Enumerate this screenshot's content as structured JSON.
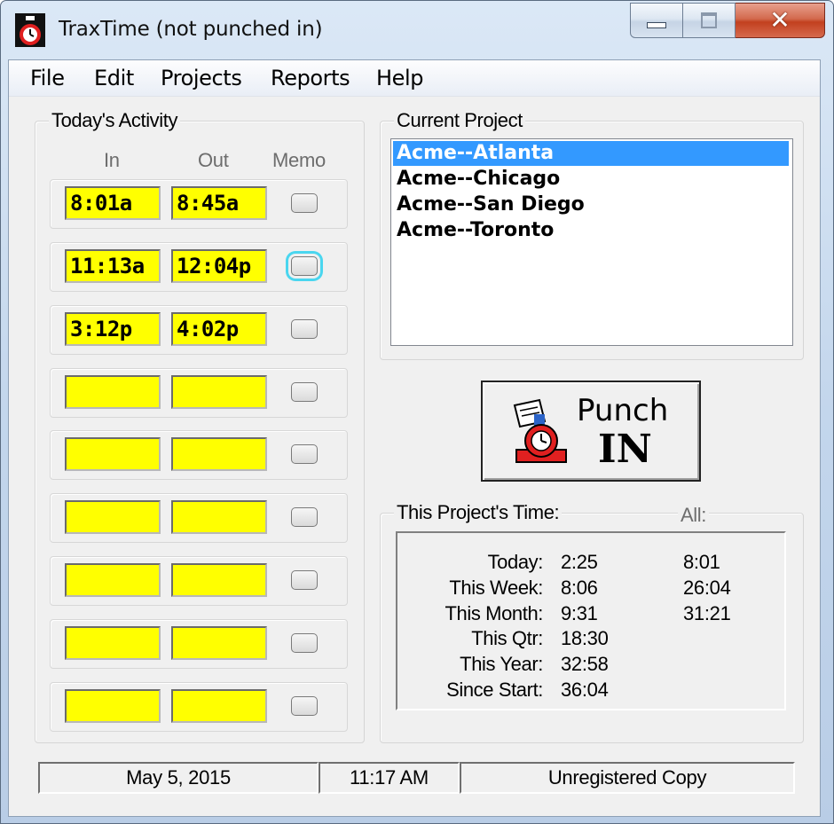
{
  "window": {
    "title": "TraxTime (not punched in)",
    "caption": {
      "minimize": "minimize",
      "maximize": "maximize",
      "close_glyph": "✕"
    }
  },
  "menu": [
    "File",
    "Edit",
    "Projects",
    "Reports",
    "Help"
  ],
  "activity": {
    "label": "Today's Activity",
    "col_in": "In",
    "col_out": "Out",
    "col_memo": "Memo",
    "rows": [
      {
        "in": "8:01a",
        "out": "8:45a"
      },
      {
        "in": "11:13a",
        "out": "12:04p"
      },
      {
        "in": "3:12p",
        "out": "4:02p"
      },
      {
        "in": "",
        "out": ""
      },
      {
        "in": "",
        "out": ""
      },
      {
        "in": "",
        "out": ""
      },
      {
        "in": "",
        "out": ""
      },
      {
        "in": "",
        "out": ""
      },
      {
        "in": "",
        "out": ""
      }
    ],
    "focused_memo_row": 2
  },
  "project": {
    "label": "Current Project",
    "items": [
      "Acme--Atlanta",
      "Acme--Chicago",
      "Acme--San Diego",
      "Acme--Toronto"
    ],
    "selected_item": 1
  },
  "punch": {
    "line1": "Punch",
    "line2": "IN"
  },
  "stats": {
    "label": "This Project's Time:",
    "all_label": "All:",
    "rows": [
      {
        "label": "Today:",
        "project": "2:25",
        "all": "8:01"
      },
      {
        "label": "This Week:",
        "project": "8:06",
        "all": "26:04"
      },
      {
        "label": "This Month:",
        "project": "9:31",
        "all": "31:21"
      },
      {
        "label": "This Qtr:",
        "project": "18:30",
        "all": ""
      },
      {
        "label": "This Year:",
        "project": "32:58",
        "all": ""
      },
      {
        "label": "Since Start:",
        "project": "36:04",
        "all": ""
      }
    ]
  },
  "status": {
    "date": "May 5, 2015",
    "time": "11:17 AM",
    "registration": "Unregistered Copy"
  },
  "colors": {
    "time_cell": "#ffff00",
    "selection": "#3399ff",
    "focus_ring": "#4ad6ef"
  },
  "icons": {
    "app": "stopwatch-icon",
    "punch": "time-clock-icon"
  }
}
